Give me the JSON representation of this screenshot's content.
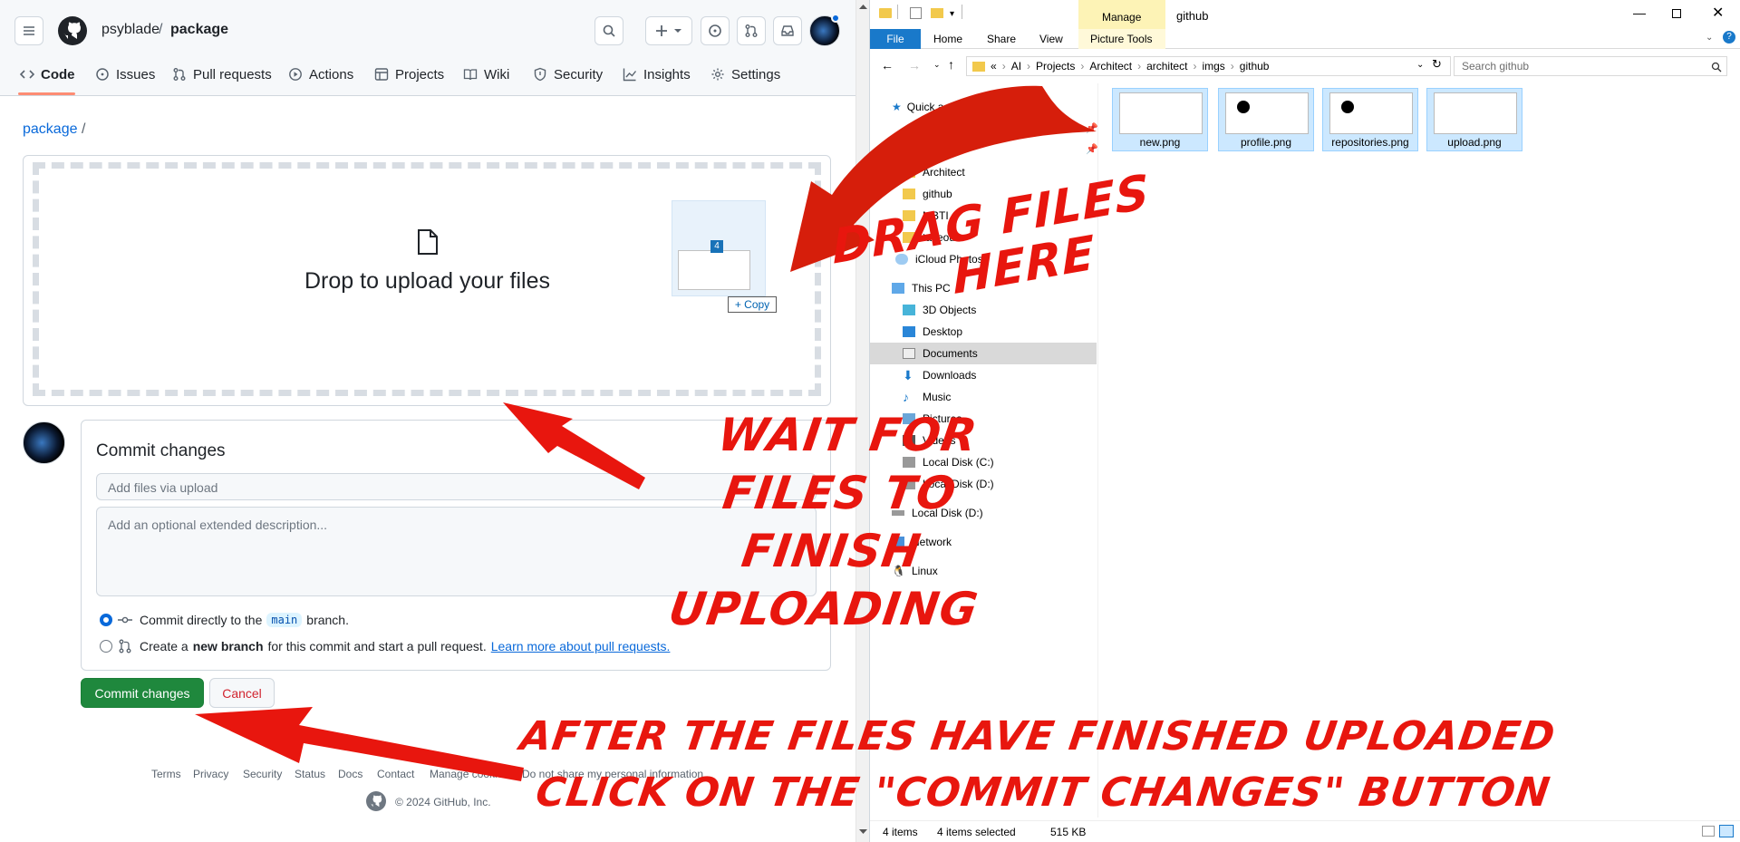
{
  "github": {
    "owner": "psyblade",
    "separator": "/",
    "repo": "package",
    "tabs": [
      "Code",
      "Issues",
      "Pull requests",
      "Actions",
      "Projects",
      "Wiki",
      "Security",
      "Insights",
      "Settings"
    ],
    "breadcrumb": "package",
    "breadcrumb_sep": "/",
    "dropzone_title": "Drop to upload your files",
    "drag_badge_count": "4",
    "drag_copy_label": "+ Copy",
    "commit_heading": "Commit changes",
    "summary_placeholder": "Add files via upload",
    "description_placeholder": "Add an optional extended description...",
    "radio1_pre": "Commit directly to the",
    "radio1_branch": "main",
    "radio1_post": "branch.",
    "radio2_pre": "Create a",
    "radio2_bold": "new branch",
    "radio2_post": "for this commit and start a pull request.",
    "radio2_link": "Learn more about pull requests.",
    "commit_button": "Commit changes",
    "cancel_button": "Cancel",
    "footer_links": [
      "Terms",
      "Privacy",
      "Security",
      "Status",
      "Docs",
      "Contact",
      "Manage cookies",
      "Do not share my personal information"
    ],
    "copyright": "© 2024 GitHub, Inc."
  },
  "explorer": {
    "title": "github",
    "manage_tab": "Manage",
    "ribbon_tabs": [
      "File",
      "Home",
      "Share",
      "View"
    ],
    "picture_tools": "Picture Tools",
    "address": [
      "«",
      "AI",
      "Projects",
      "Architect",
      "architect",
      "imgs",
      "github"
    ],
    "search_placeholder": "Search github",
    "nav": [
      "Quick access",
      "Projects",
      "Architect",
      "github",
      "MBTI",
      "takeout",
      "iCloud Photos",
      "This PC",
      "3D Objects",
      "Desktop",
      "Documents",
      "Downloads",
      "Music",
      "Pictures",
      "Videos",
      "Local Disk (C:)",
      "Local Disk (D:)",
      "Local Disk (D:)",
      "Network",
      "Linux"
    ],
    "files": [
      "new.png",
      "profile.png",
      "repositories.png",
      "upload.png"
    ],
    "status_items": "4 items",
    "status_selected": "4 items selected",
    "status_size": "515 KB",
    "colors": {
      "selection": "#cce8ff",
      "file_tab": "#1979ca",
      "manage_tab": "#fdf3b6"
    }
  },
  "annotations": {
    "drag": [
      "DRAG FILES",
      "HERE"
    ],
    "wait": [
      "WAIT FOR",
      "FILES TO",
      "FINISH",
      "UPLOADING"
    ],
    "after": [
      "AFTER THE FILES HAVE FINISHED UPLOADED",
      "CLICK ON THE \"COMMIT CHANGES\" BUTTON"
    ],
    "color": "#e8160e"
  }
}
